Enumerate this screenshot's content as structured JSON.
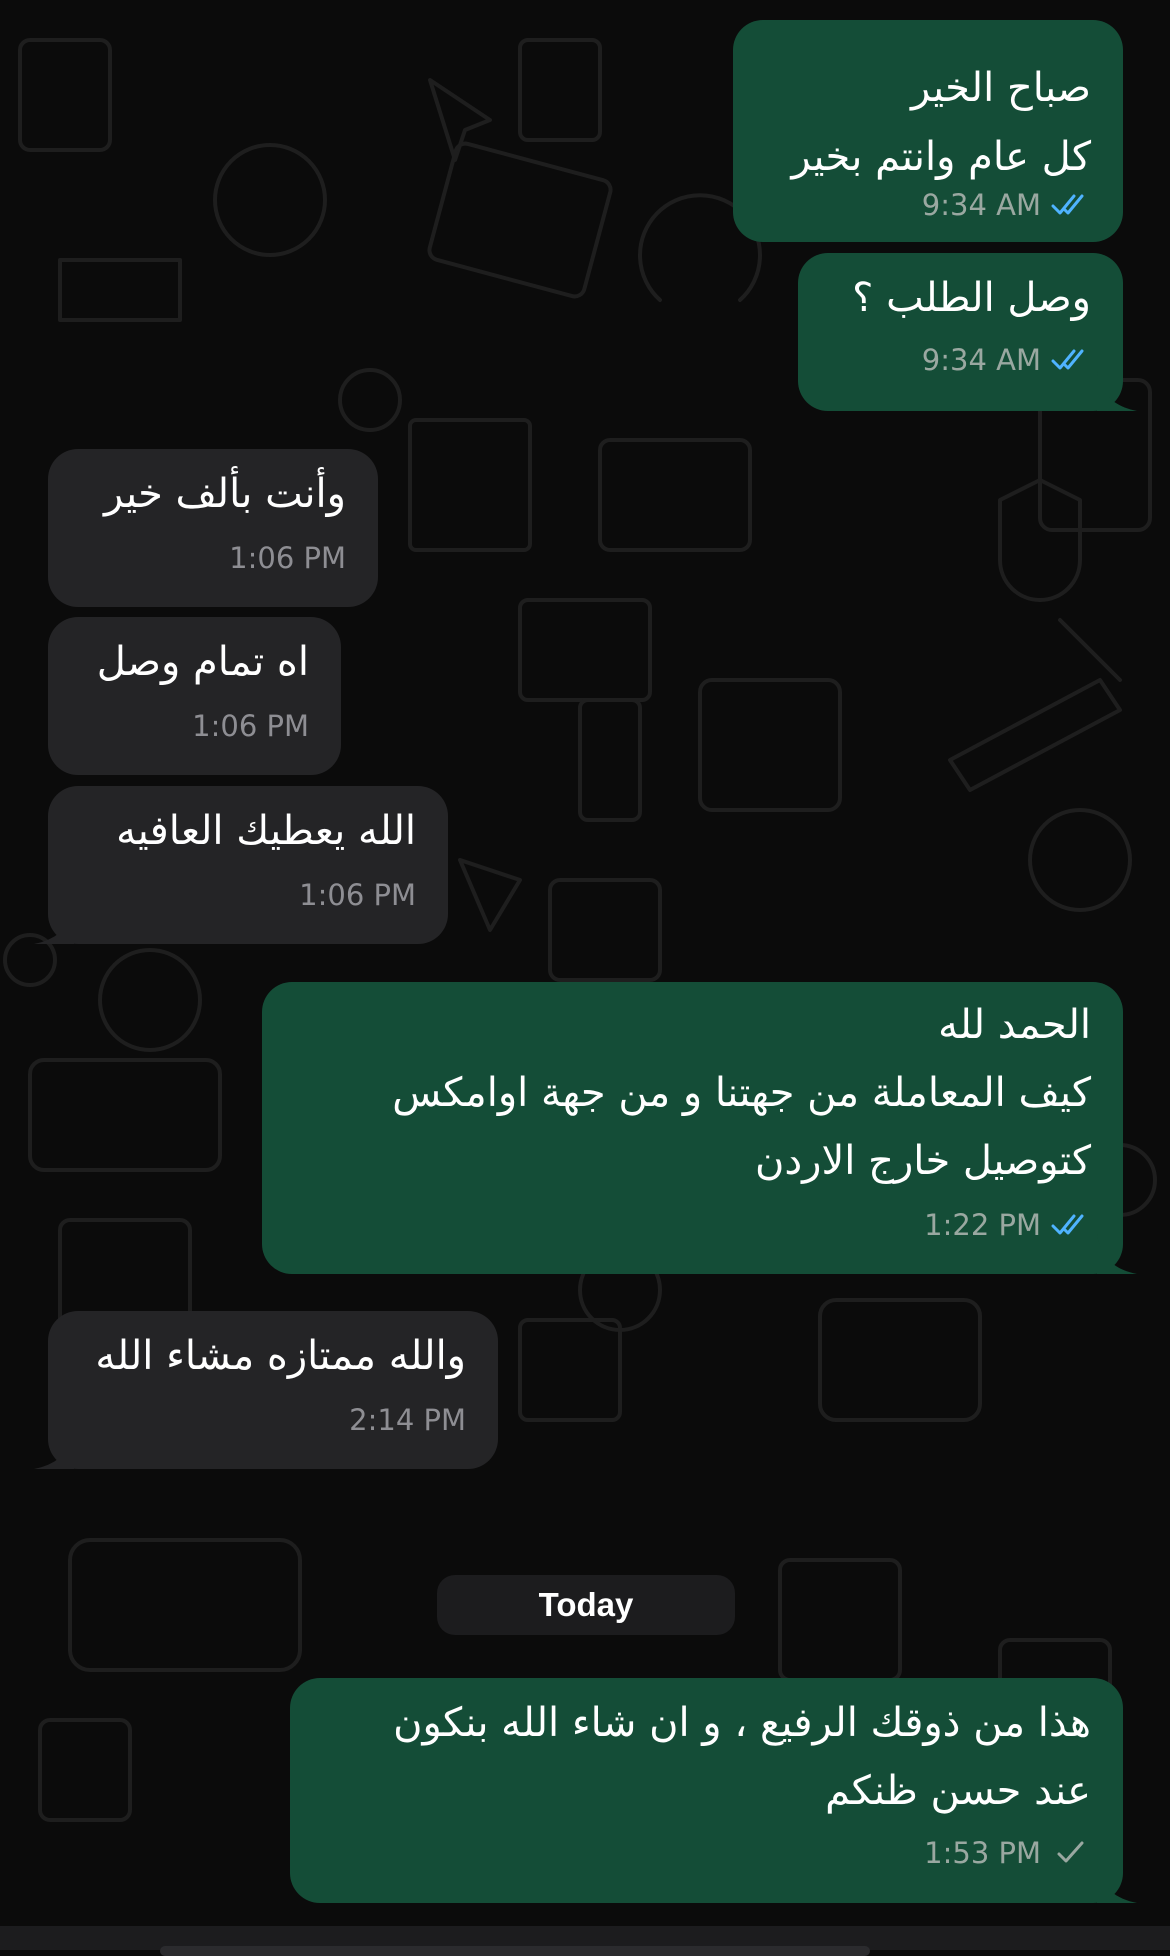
{
  "chat": {
    "messages": [
      {
        "id": "m1",
        "dir": "out",
        "lines": [
          "صباح الخير",
          "كل عام وانتم بخير"
        ],
        "time": "9:34 AM",
        "status": "read"
      },
      {
        "id": "m2",
        "dir": "out",
        "lines": [
          "وصل الطلب ؟"
        ],
        "time": "9:34 AM",
        "status": "read"
      },
      {
        "id": "m3",
        "dir": "in",
        "lines": [
          "وأنت بألف خير"
        ],
        "time": "1:06 PM"
      },
      {
        "id": "m4",
        "dir": "in",
        "lines": [
          "اه تمام وصل"
        ],
        "time": "1:06 PM"
      },
      {
        "id": "m5",
        "dir": "in",
        "lines": [
          "الله يعطيك العافيه"
        ],
        "time": "1:06 PM"
      },
      {
        "id": "m6",
        "dir": "out",
        "lines": [
          "الحمد لله",
          "كيف المعاملة من جهتنا و من جهة اوامكس",
          "كتوصيل خارج الاردن"
        ],
        "time": "1:22 PM",
        "status": "read"
      },
      {
        "id": "m7",
        "dir": "in",
        "lines": [
          "والله ممتازه مشاء الله"
        ],
        "time": "2:14 PM"
      },
      {
        "id": "m8",
        "dir": "out",
        "lines": [
          "هذا من ذوقك الرفيع ، و ان شاء الله بنكون",
          "عند حسن ظنكم"
        ],
        "time": "1:53 PM",
        "status": "sent"
      }
    ],
    "date_separator": "Today"
  },
  "colors": {
    "background": "#0b0b0b",
    "outgoing_bubble": "#144d37",
    "incoming_bubble": "#242426",
    "read_ticks": "#4fb3ff",
    "sent_tick": "#9aa8a1"
  },
  "icons": {
    "read": "double-check-icon",
    "sent": "single-check-icon"
  }
}
